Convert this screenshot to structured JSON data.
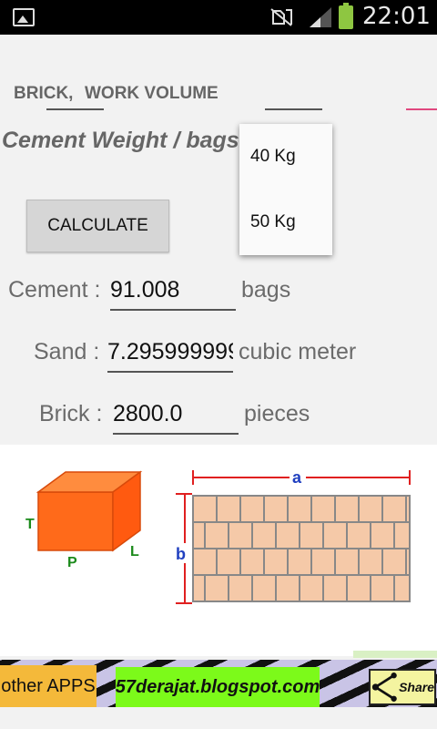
{
  "status_bar": {
    "time": "22:01",
    "icons": [
      "picture-icon",
      "mute-icon",
      "signal-icon",
      "battery-icon"
    ],
    "battery_color": "#8ec641"
  },
  "inputs": {
    "brick_label": "BRICK,",
    "work_volume_label": "WORK VOLUME"
  },
  "cement_weight": {
    "label": "Cement Weight / bags :",
    "options": [
      "40 Kg",
      "50 Kg"
    ]
  },
  "calculate_button": "CALCULATE",
  "results": {
    "cement": {
      "label": "Cement :",
      "value": "91.008",
      "unit": "bags"
    },
    "sand": {
      "label": "Sand :",
      "value": "7.295999999",
      "unit": "cubic meter"
    },
    "brick": {
      "label": "Brick :",
      "value": "2800.0",
      "unit": "pieces"
    }
  },
  "illustration": {
    "box_labels": {
      "t": "T",
      "p": "P",
      "l": "L"
    },
    "wall_labels": {
      "a": "a",
      "b": "b"
    }
  },
  "ads": {
    "other_apps": "other APPS",
    "blog": "57derajat.blogspot.com",
    "share": "Share"
  },
  "colors": {
    "accent_pink": "#e0487e",
    "brick_fill": "#f5c9a8",
    "box_orange": "#ff6a1a",
    "ad_green": "#7cfa1a",
    "ad_orange": "#f4b93a"
  }
}
